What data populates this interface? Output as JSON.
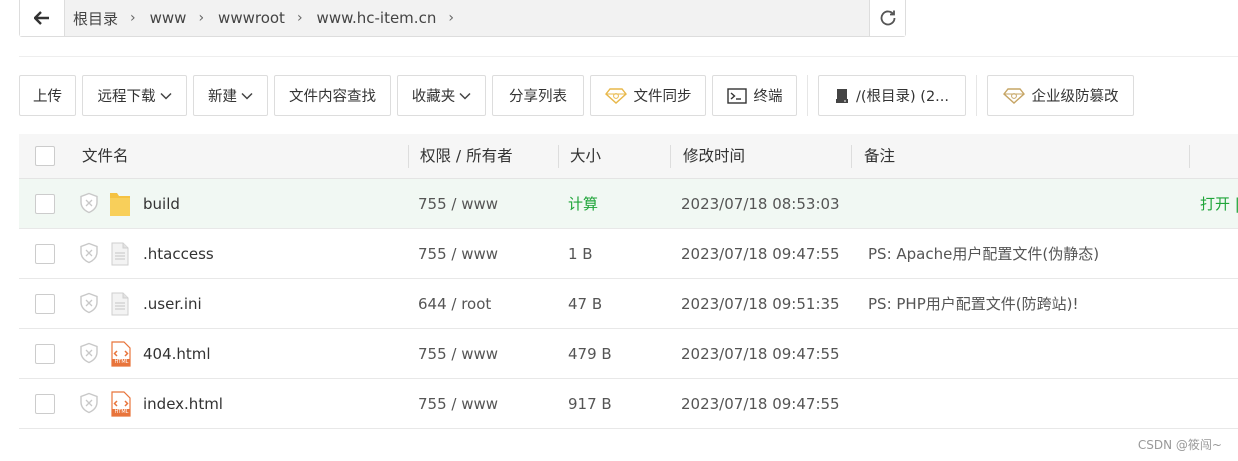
{
  "breadcrumb": {
    "items": [
      "根目录",
      "www",
      "wwwroot",
      "www.hc-item.cn"
    ]
  },
  "toolbar": {
    "upload": "上传",
    "remote_download": "远程下载",
    "new": "新建",
    "content_search": "文件内容查找",
    "favorites": "收藏夹",
    "share_list": "分享列表",
    "file_sync": "文件同步",
    "terminal": "终端",
    "disk": "/(根目录) (2...",
    "enterprise_tamper": "企业级防篡改"
  },
  "table": {
    "headers": {
      "name": "文件名",
      "perm": "权限 / 所有者",
      "size": "大小",
      "mtime": "修改时间",
      "note": "备注"
    },
    "rows": [
      {
        "name": "build",
        "type": "folder",
        "perm": "755 / www",
        "size": "计算",
        "mtime": "2023/07/18 08:53:03",
        "note": "",
        "action": "打开 |"
      },
      {
        "name": ".htaccess",
        "type": "file",
        "perm": "755 / www",
        "size": "1 B",
        "mtime": "2023/07/18 09:47:55",
        "note": "PS: Apache用户配置文件(伪静态)",
        "action": ""
      },
      {
        "name": ".user.ini",
        "type": "file",
        "perm": "644 / root",
        "size": "47 B",
        "mtime": "2023/07/18 09:51:35",
        "note": "PS: PHP用户配置文件(防跨站)!",
        "action": ""
      },
      {
        "name": "404.html",
        "type": "html",
        "perm": "755 / www",
        "size": "479 B",
        "mtime": "2023/07/18 09:47:55",
        "note": "",
        "action": ""
      },
      {
        "name": "index.html",
        "type": "html",
        "perm": "755 / www",
        "size": "917 B",
        "mtime": "2023/07/18 09:47:55",
        "note": "",
        "action": ""
      }
    ]
  },
  "html_badge": "HTML",
  "watermark": "CSDN @筱闯~",
  "colors": {
    "accent_green": "#20a53a",
    "gem_gold": "#e8b84a",
    "folder_yellow": "#f5c242"
  }
}
